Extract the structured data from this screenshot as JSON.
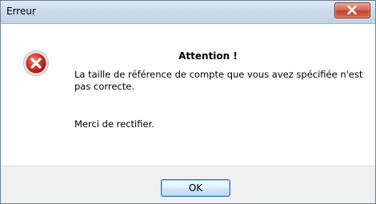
{
  "window": {
    "title": "Erreur"
  },
  "dialog": {
    "heading": "Attention !",
    "message_line1": "La taille de référence de compte que vous avez spécifiée n'est",
    "message_line2": "pas correcte.",
    "message_secondary": "Merci de rectifier."
  },
  "buttons": {
    "ok_label": "OK"
  },
  "icons": {
    "close": "close-icon",
    "error": "error-icon"
  },
  "colors": {
    "error_red": "#d8332a",
    "close_button": "#c7452f",
    "footer_background": "#f0f0f0"
  }
}
